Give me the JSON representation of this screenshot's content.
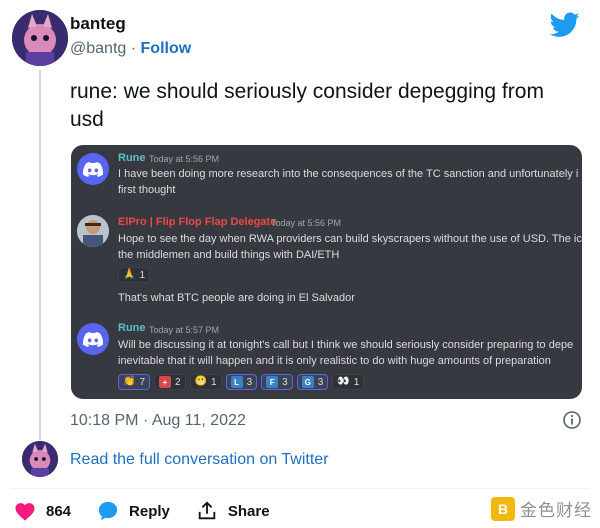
{
  "author": {
    "name": "banteg",
    "handle": "@bantg",
    "separator": "·",
    "follow_label": "Follow"
  },
  "tweet": {
    "text": "rune: we should seriously consider depegging from usd",
    "time": "10:18 PM",
    "date_separator": "·",
    "date": "Aug 11, 2022"
  },
  "discord": {
    "messages": [
      {
        "author": "Rune",
        "author_color": "#5cc0c8",
        "timestamp": "Today at 5:56 PM",
        "lines": [
          "I have been doing more research into the consequences of the TC sanction and unfortunately i",
          "first thought"
        ]
      },
      {
        "author": "ElPro | Flip Flop Flap Delegate",
        "author_color": "#f04747",
        "timestamp": "Today at 5:56 PM",
        "lines": [
          "Hope to see the day when RWA providers can build skyscrapers without the use of USD. The ic",
          "the middlemen and build things with DAI/ETH"
        ],
        "reactions": [
          {
            "emoji": "🙏",
            "count": "1"
          }
        ],
        "followup": "That's what BTC people are doing in El Salvador"
      },
      {
        "author": "Rune",
        "author_color": "#5cc0c8",
        "timestamp": "Today at 5:57 PM",
        "lines": [
          "Will be discussing it at tonight's call but I think we should seriously consider preparing to depe",
          "inevitable that it will happen and it is only realistic to do with huge amounts of preparation"
        ],
        "reactions": [
          {
            "emoji": "👏",
            "count": "7"
          },
          {
            "emoji": "+",
            "count": "2"
          },
          {
            "emoji": "😬",
            "count": "1"
          },
          {
            "emoji": "L",
            "count": "3"
          },
          {
            "emoji": "F",
            "count": "3"
          },
          {
            "emoji": "G",
            "count": "3"
          },
          {
            "emoji": "👀",
            "count": "1"
          }
        ]
      }
    ]
  },
  "read_full_label": "Read the full conversation on Twitter",
  "actions": {
    "like_count": "864",
    "reply_label": "Reply",
    "share_label": "Share"
  },
  "watermark": {
    "logo_char": "B",
    "text": "金色财经"
  },
  "colors": {
    "twitter_blue": "#1d9bf0",
    "link": "#1d6fbf",
    "like_red": "#f91880",
    "discord_bg": "#36393f",
    "discord_blurple": "#5865f2"
  }
}
